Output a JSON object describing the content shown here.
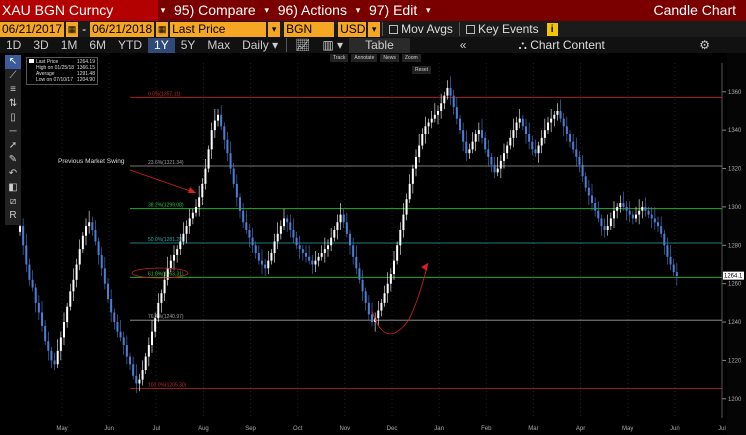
{
  "titlebar": {
    "ticker": "XAU BGN Curncy",
    "compare": "95) Compare",
    "actions": "96) Actions",
    "edit": "97) Edit",
    "chart_title": "Candle Chart"
  },
  "fields": {
    "start_date": "06/21/2017",
    "end_date": "06/21/2018",
    "price_type": "Last Price",
    "source": "BGN",
    "currency": "USD",
    "mov_avgs": "Mov Avgs",
    "key_events": "Key Events",
    "info": "i"
  },
  "periods": {
    "items": [
      "1D",
      "3D",
      "1M",
      "6M",
      "YTD",
      "1Y",
      "5Y",
      "Max"
    ],
    "active": "1Y",
    "frequency": "Daily",
    "table": "Table",
    "chart_content": "Chart Content"
  },
  "legend": {
    "rows": [
      {
        "label": "Last Price",
        "value": "1264.19",
        "color": "#ffffff"
      },
      {
        "label": "High on 01/25/18",
        "value": "1366.15",
        "color": ""
      },
      {
        "label": "Average",
        "value": "1291.48",
        "color": ""
      },
      {
        "label": "Low on 07/10/17",
        "value": "1204.90",
        "color": ""
      }
    ]
  },
  "minitools": {
    "track": "Track",
    "annotate": "Annotate",
    "news": "News",
    "zoom": "Zoom",
    "reset": "Reset"
  },
  "colors": {
    "titlebar": "#7a0000",
    "field": "#f5a623",
    "active_period": "#2e4a78",
    "up_candle": "#ffffff",
    "down_candle": "#4a7fd6",
    "annotation": "#d42020"
  },
  "chart_data": {
    "type": "candlestick",
    "ylim": [
      1190,
      1375
    ],
    "y_ticks": [
      1200,
      1220,
      1240,
      1260,
      1280,
      1300,
      1320,
      1340,
      1360
    ],
    "x_ticks": [
      "May",
      "Jun",
      "Jul",
      "Aug",
      "Sep",
      "Oct",
      "Nov",
      "Dec",
      "Jan",
      "Feb",
      "Mar",
      "Apr",
      "May",
      "Jun",
      "Jul"
    ],
    "last_price_label": "1264.1",
    "fib_levels": [
      {
        "label": "0.0%(1357.11)",
        "value": 1357.11,
        "color": "#c0282a"
      },
      {
        "label": "23.6%(1321.34)",
        "value": 1321.34,
        "color": "#a0a0a0"
      },
      {
        "label": "38.2%(1299.08)",
        "value": 1299.08,
        "color": "#35c235"
      },
      {
        "label": "50.0%(1281.20)",
        "value": 1281.2,
        "color": "#2aa8a8"
      },
      {
        "label": "61.8%(1263.31)",
        "value": 1263.31,
        "color": "#35c235"
      },
      {
        "label": "76.4%(1240.97)",
        "value": 1240.97,
        "color": "#a0a0a0"
      },
      {
        "label": "100.0%(1205.30)",
        "value": 1205.3,
        "color": "#c0282a"
      }
    ],
    "annotation_text": "Previous Market Swing",
    "closes": [
      1290,
      1280,
      1270,
      1262,
      1258,
      1250,
      1245,
      1238,
      1230,
      1225,
      1220,
      1218,
      1225,
      1232,
      1240,
      1248,
      1256,
      1262,
      1270,
      1278,
      1285,
      1290,
      1292,
      1288,
      1282,
      1275,
      1268,
      1260,
      1252,
      1245,
      1240,
      1235,
      1232,
      1228,
      1222,
      1218,
      1212,
      1208,
      1210,
      1215,
      1222,
      1228,
      1235,
      1242,
      1250,
      1255,
      1262,
      1268,
      1272,
      1275,
      1278,
      1282,
      1286,
      1290,
      1294,
      1297,
      1300,
      1305,
      1312,
      1320,
      1330,
      1340,
      1345,
      1348,
      1342,
      1335,
      1328,
      1320,
      1312,
      1305,
      1298,
      1292,
      1288,
      1284,
      1280,
      1276,
      1272,
      1270,
      1268,
      1272,
      1276,
      1282,
      1286,
      1290,
      1294,
      1292,
      1288,
      1284,
      1280,
      1278,
      1276,
      1274,
      1272,
      1270,
      1272,
      1274,
      1276,
      1278,
      1280,
      1284,
      1288,
      1292,
      1296,
      1292,
      1286,
      1280,
      1274,
      1268,
      1262,
      1256,
      1250,
      1244,
      1240,
      1242,
      1246,
      1250,
      1255,
      1260,
      1265,
      1272,
      1280,
      1288,
      1296,
      1304,
      1312,
      1320,
      1326,
      1332,
      1338,
      1342,
      1344,
      1346,
      1348,
      1350,
      1354,
      1358,
      1362,
      1358,
      1352,
      1346,
      1340,
      1334,
      1328,
      1330,
      1334,
      1338,
      1340,
      1336,
      1330,
      1326,
      1322,
      1318,
      1320,
      1324,
      1328,
      1332,
      1336,
      1340,
      1344,
      1346,
      1342,
      1338,
      1334,
      1330,
      1328,
      1332,
      1336,
      1340,
      1344,
      1346,
      1348,
      1350,
      1346,
      1342,
      1338,
      1334,
      1330,
      1326,
      1322,
      1316,
      1310,
      1306,
      1302,
      1298,
      1294,
      1290,
      1288,
      1290,
      1294,
      1298,
      1300,
      1302,
      1300,
      1298,
      1296,
      1294,
      1296,
      1298,
      1300,
      1298,
      1296,
      1294,
      1292,
      1290,
      1286,
      1280,
      1274,
      1270,
      1266,
      1264
    ]
  }
}
